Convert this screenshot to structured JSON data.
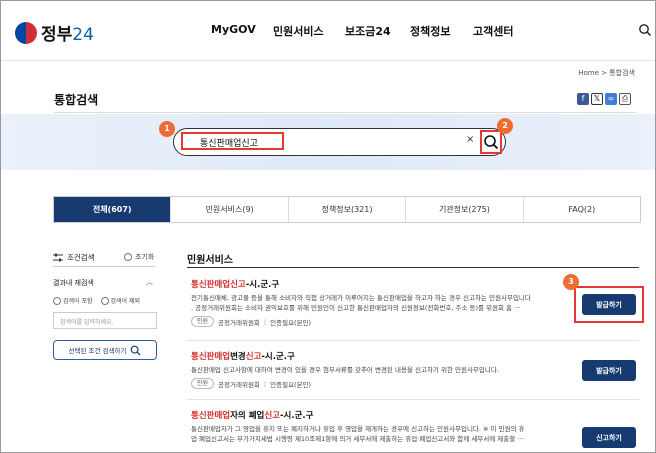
{
  "brand": {
    "logo_text": "정부",
    "logo_num": "24"
  },
  "nav": [
    "MyGOV",
    "민원서비스",
    "보조금24",
    "정책정보",
    "고객센터"
  ],
  "breadcrumb": "Home > 통합검색",
  "page_title": "통합검색",
  "share_icons": [
    "facebook-icon",
    "x-icon",
    "link-icon",
    "print-icon"
  ],
  "search": {
    "value": "통신판매업신고",
    "clear": "×"
  },
  "annotations": [
    "1",
    "2",
    "3"
  ],
  "tabs": [
    "전체(607)",
    "민원서비스(9)",
    "정책정보(321)",
    "기관정보(275)",
    "FAQ(2)"
  ],
  "filter": {
    "title": "조건검색",
    "reset": "초기화",
    "re_search": "결과내 재검색",
    "include": "검색어 포함",
    "exclude": "검색어 제외",
    "placeholder": "검색어를 입력하세요.",
    "apply": "선택된 조건 검색하기"
  },
  "section_title": "민원서비스",
  "results": [
    {
      "title_hl": "통신판매업신고",
      "title_rest": "-시.군.구",
      "desc1": "전기통신매체, 광고물 등을 통해 소비자와 직접 상거래가 이루어지는 통신판매업을 하고자 하는 경우 신고하는 민원사무입니다",
      "desc2": ". 공정거래위원회는 소비자 권익보호를 위해 민원인이 신고한 통신판매업자의 신원정보(전화번호, 주소 등)를 위원회 홈 ···",
      "tag": "민원",
      "org": "공정거래위원회",
      "auth": "인증필요(본인)",
      "button": "발급하기"
    },
    {
      "title_pre": "통신판매업",
      "title_mid": "변경",
      "title_hl2": "신고",
      "title_rest": "-시.군.구",
      "desc1": "통신판매업 신고사항에 대하여 변경이 있을 경우 첨부서류를 갖추어 변경된 내용을 신고하기 위한 민원사무입니다.",
      "tag": "민원",
      "org": "공정거래위원회",
      "auth": "인증필요(본인)",
      "button": "발급하기"
    },
    {
      "title_hl": "통신판매업",
      "title_mid": "자의 폐업",
      "title_hl2": "신고",
      "title_rest": "-시.군.구",
      "desc1": "통신판매업자가 그 영업을 휴지 또는 폐지하거나 휴업 후 영업을 재개하는 경우에 신고하는 민원사무입니다. ※ 이 민원의 휴",
      "desc2": "업·폐업신고서는 부가가치세법 시행령 제10조제1항에 의거 세무서에 제출하는 휴업·폐업신고서와 함께 세무서에 제출할 ···",
      "button": "신고하기"
    }
  ]
}
